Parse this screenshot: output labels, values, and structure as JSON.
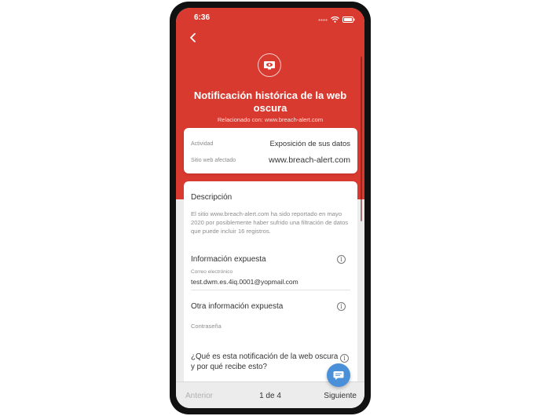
{
  "status_bar": {
    "time": "6:36"
  },
  "header": {
    "title": "Notificación histórica de la web oscura",
    "related": "Relacionado con: www.breach-alert.com"
  },
  "activity_card": {
    "activity_label": "Actividad",
    "activity_value": "Exposición de sus datos",
    "site_label": "Sitio web afectado",
    "site_value": "www.breach-alert.com"
  },
  "description": {
    "title": "Descripción",
    "text": "El sitio www.breach-alert.com ha sido reportado en mayo 2020 por posiblemente haber sufrido una filtración de datos que puede incluir 16 registros."
  },
  "exposed_info": {
    "title": "Información expuesta",
    "email_label": "Correo electrónico",
    "email_value": "test.dwm.es.4iq.0001@yopmail.com"
  },
  "other_info": {
    "title": "Otra información expuesta",
    "value": "Contraseña"
  },
  "faq": {
    "title": "¿Qué es esta notificación de la web oscura y por qué recibe esto?"
  },
  "pagination": {
    "prev": "Anterior",
    "page": "1 de 4",
    "next": "Siguiente"
  },
  "colors": {
    "brand_red": "#d93a30",
    "chat_blue": "#4a90d9"
  },
  "icons": [
    "back-chevron-icon",
    "wifi-icon",
    "battery-icon",
    "monitor-eye-icon",
    "info-icon",
    "chat-icon"
  ]
}
